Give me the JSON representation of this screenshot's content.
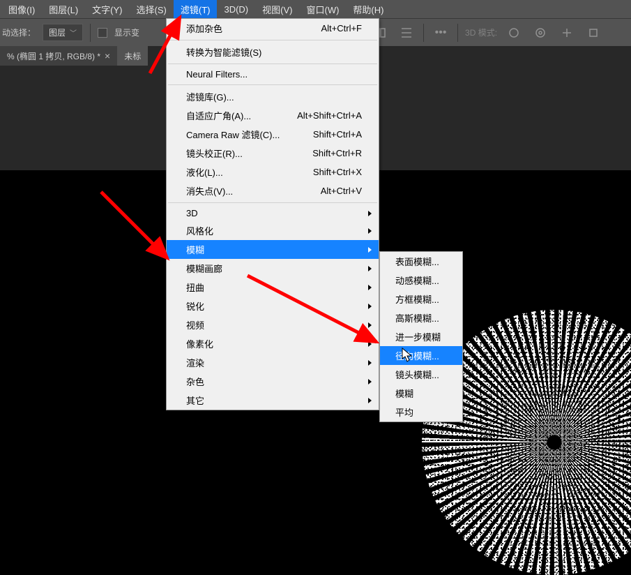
{
  "menubar": {
    "items": [
      {
        "label": "图像(I)"
      },
      {
        "label": "图层(L)"
      },
      {
        "label": "文字(Y)"
      },
      {
        "label": "选择(S)"
      },
      {
        "label": "滤镜(T)",
        "active": true
      },
      {
        "label": "3D(D)"
      },
      {
        "label": "视图(V)"
      },
      {
        "label": "窗口(W)"
      },
      {
        "label": "帮助(H)"
      }
    ]
  },
  "optionsbar": {
    "auto_select_label": "动选择：",
    "layer_select": "图层",
    "show_transform_label": "显示变",
    "mode_label": "3D 模式:"
  },
  "tabbar": {
    "doc_tab": "% (椭圆 1 拷贝, RGB/8) *",
    "doc_tab2_prefix": "未标"
  },
  "filter_menu": {
    "last_filter": {
      "label": "添加杂色",
      "shortcut": "Alt+Ctrl+F"
    },
    "smart": {
      "label": "转换为智能滤镜(S)"
    },
    "neural": {
      "label": "Neural Filters..."
    },
    "gallery": {
      "label": "滤镜库(G)..."
    },
    "adaptive": {
      "label": "自适应广角(A)...",
      "shortcut": "Alt+Shift+Ctrl+A"
    },
    "camera": {
      "label": "Camera Raw 滤镜(C)...",
      "shortcut": "Shift+Ctrl+A"
    },
    "lens": {
      "label": "镜头校正(R)...",
      "shortcut": "Shift+Ctrl+R"
    },
    "liquify": {
      "label": "液化(L)...",
      "shortcut": "Shift+Ctrl+X"
    },
    "vanishing": {
      "label": "消失点(V)...",
      "shortcut": "Alt+Ctrl+V"
    },
    "sub_3d": {
      "label": "3D"
    },
    "sub_stylize": {
      "label": "风格化"
    },
    "sub_blur": {
      "label": "模糊"
    },
    "sub_blurgallery": {
      "label": "模糊画廊"
    },
    "sub_distort": {
      "label": "扭曲"
    },
    "sub_sharpen": {
      "label": "锐化"
    },
    "sub_video": {
      "label": "视频"
    },
    "sub_pixelate": {
      "label": "像素化"
    },
    "sub_render": {
      "label": "渲染"
    },
    "sub_noise": {
      "label": "杂色"
    },
    "sub_other": {
      "label": "其它"
    }
  },
  "blur_submenu": {
    "surface": {
      "label": "表面模糊..."
    },
    "motion": {
      "label": "动感模糊..."
    },
    "box": {
      "label": "方框模糊..."
    },
    "gaussian": {
      "label": "高斯模糊..."
    },
    "more": {
      "label": "进一步模糊"
    },
    "radial": {
      "label": "径向模糊..."
    },
    "lens": {
      "label": "镜头模糊..."
    },
    "blur": {
      "label": "模糊"
    },
    "average": {
      "label": "平均"
    }
  }
}
